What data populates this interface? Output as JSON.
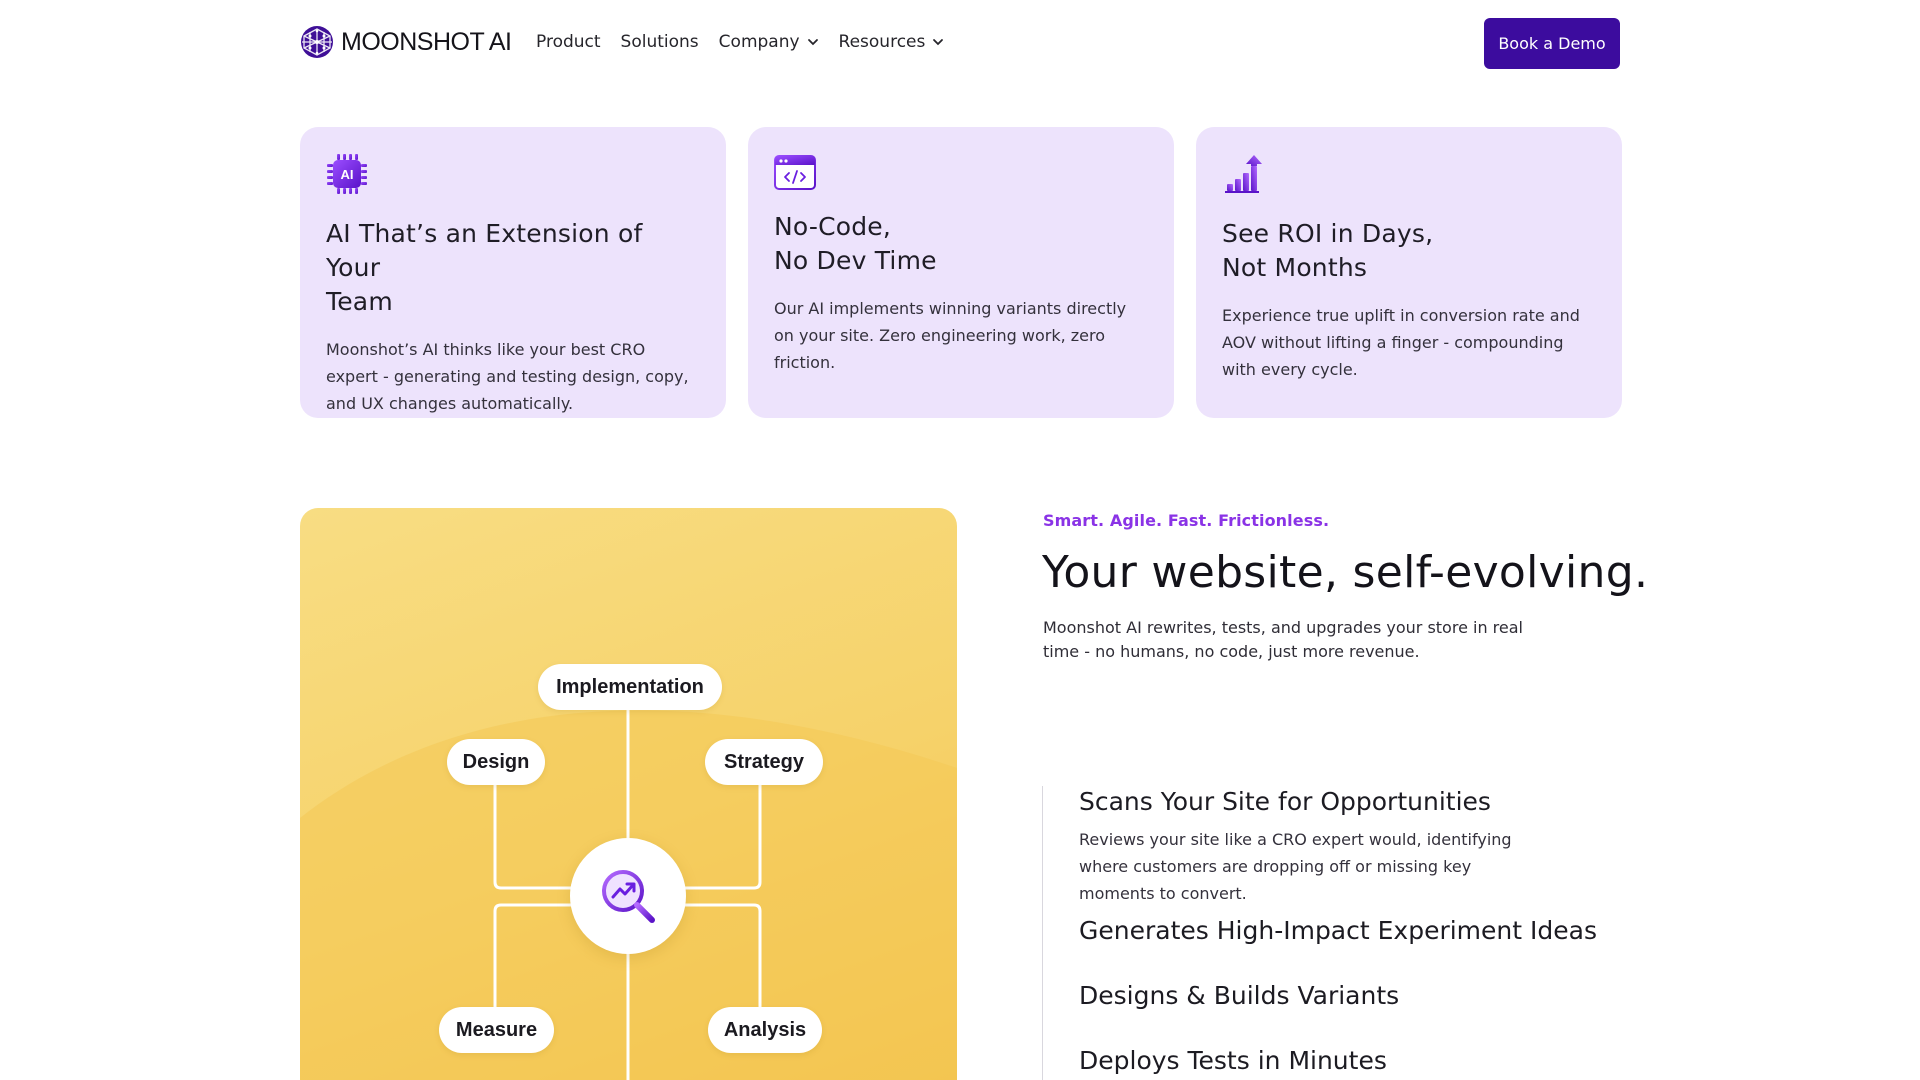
{
  "header": {
    "brand": "MOONSHOT AI",
    "nav": [
      {
        "label": "Product",
        "has_dropdown": false
      },
      {
        "label": "Solutions",
        "has_dropdown": false
      },
      {
        "label": "Company",
        "has_dropdown": true
      },
      {
        "label": "Resources",
        "has_dropdown": true
      }
    ],
    "cta": "Book a Demo"
  },
  "features": [
    {
      "icon": "ai-chip-icon",
      "title": "AI That’s an Extension of Your\nTeam",
      "description": "Moonshot’s AI thinks like your best CRO expert - generating and testing design, copy, and UX changes automatically."
    },
    {
      "icon": "code-window-icon",
      "title": "No-Code,\nNo Dev Time",
      "description": "Our AI implements winning variants directly on your site. Zero engineering work, zero friction."
    },
    {
      "icon": "growth-bars-icon",
      "title": "See ROI in Days,\nNot Months",
      "description": "Experience true uplift in conversion rate and AOV without lifting a finger - compounding with every cycle."
    }
  ],
  "diagram": {
    "nodes": [
      "Implementation",
      "Design",
      "Strategy",
      "Measure",
      "Analysis"
    ],
    "hub_icon": "magnifier-trend-icon"
  },
  "hero": {
    "eyebrow": "Smart. Agile. Fast. Frictionless.",
    "headline": "Your website, self-evolving.",
    "lead": "Moonshot AI rewrites, tests, and upgrades your store in real time - no humans, no code, just more revenue."
  },
  "steps": [
    {
      "title": "Scans Your Site for Opportunities",
      "description": "Reviews your site like a CRO expert would, identifying where customers are dropping off or missing key moments to convert.",
      "expanded": true
    },
    {
      "title": "Generates High-Impact Experiment Ideas",
      "expanded": false
    },
    {
      "title": "Designs & Builds Variants",
      "expanded": false
    },
    {
      "title": "Deploys Tests in Minutes",
      "expanded": false
    }
  ],
  "colors": {
    "brand_purple": "#3c0c9e",
    "accent_purple": "#8a33e6",
    "card_bg": "#ede3fc",
    "panel_yellow": "#f6d26a"
  }
}
